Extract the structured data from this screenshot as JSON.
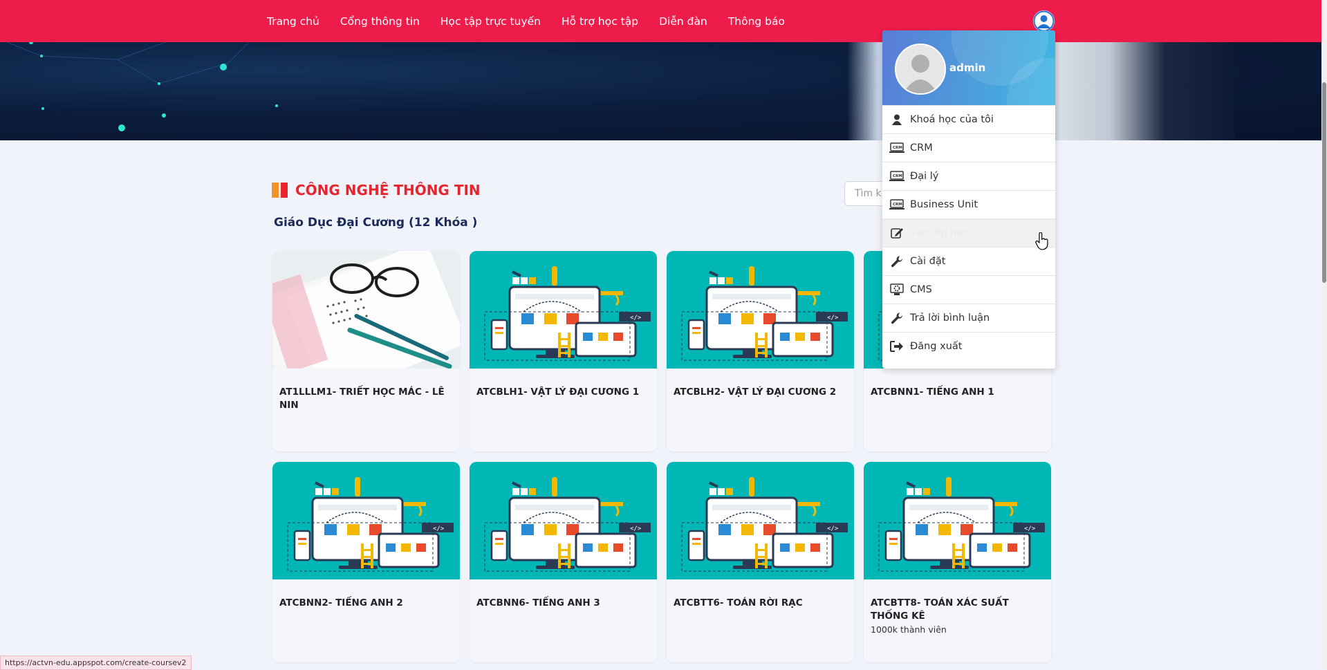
{
  "nav": {
    "items": [
      {
        "label": "Trang chủ"
      },
      {
        "label": "Cổng thông tin"
      },
      {
        "label": "Học tập trực tuyến"
      },
      {
        "label": "Hỗ trợ học tập"
      },
      {
        "label": "Diễn đàn"
      },
      {
        "label": "Thông báo"
      }
    ],
    "user_icon": "user-avatar-icon"
  },
  "section": {
    "title": "CÔNG NGHỆ THÔNG TIN",
    "subtitle": "Giáo Dục Đại Cương (12 Khóa )",
    "search_placeholder": "Tìm ki"
  },
  "courses": [
    {
      "title": "AT1LLLM1- TRIẾT HỌC MÁC - LÊ NIN",
      "thumb": "glasses-exam-photo"
    },
    {
      "title": "ATCBLH1- VẬT LÝ ĐẠI CƯƠNG 1",
      "thumb": "web-design-illustration"
    },
    {
      "title": "ATCBLH2- VẬT LÝ ĐẠI CƯƠNG 2",
      "thumb": "web-design-illustration"
    },
    {
      "title": "ATCBNN1- TIẾNG ANH 1",
      "thumb": "web-design-illustration"
    },
    {
      "title": "ATCBNN2- TIẾNG ANH 2",
      "thumb": "web-design-illustration"
    },
    {
      "title": "ATCBNN6- TIẾNG ANH 3",
      "thumb": "web-design-illustration"
    },
    {
      "title": "ATCBTT6- TOÁN RỜI RẠC",
      "thumb": "web-design-illustration"
    },
    {
      "title": "ATCBTT8- TOÁN XÁC SUẤT THỐNG KÊ",
      "thumb": "web-design-illustration",
      "meta": "1000k thành viên"
    }
  ],
  "dropdown": {
    "username": "admin",
    "items": [
      {
        "label": "Khoá học của tôi",
        "icon": "user-icon"
      },
      {
        "label": "CRM",
        "icon": "crm-laptop-icon"
      },
      {
        "label": "Đại lý",
        "icon": "crm-laptop-icon"
      },
      {
        "label": "Business Unit",
        "icon": "crm-laptop-icon"
      },
      {
        "label": "Tạo lớp học",
        "icon": "edit-icon",
        "state": "hover"
      },
      {
        "label": "Cài đặt",
        "icon": "wrench-icon"
      },
      {
        "label": "CMS",
        "icon": "cms-gear-icon"
      },
      {
        "label": "Trả lời bình luận",
        "icon": "wrench-icon"
      },
      {
        "label": "Đăng xuất",
        "icon": "logout-icon"
      }
    ]
  },
  "status_url": "https://actvn-edu.appspot.com/create-coursev2",
  "colors": {
    "nav_bg": "#ee1c4a",
    "title_red": "#e8242e",
    "teal_thumb": "#00b7b5"
  }
}
